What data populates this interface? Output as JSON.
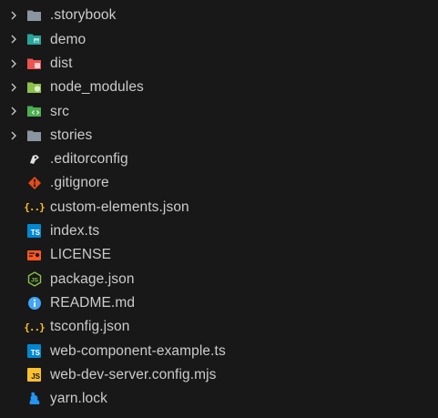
{
  "explorer": {
    "folders": [
      {
        "label": ".storybook"
      },
      {
        "label": "demo"
      },
      {
        "label": "dist"
      },
      {
        "label": "node_modules"
      },
      {
        "label": "src"
      },
      {
        "label": "stories"
      }
    ],
    "files": [
      {
        "label": ".editorconfig"
      },
      {
        "label": ".gitignore"
      },
      {
        "label": "custom-elements.json"
      },
      {
        "label": "index.ts"
      },
      {
        "label": "LICENSE"
      },
      {
        "label": "package.json"
      },
      {
        "label": "README.md"
      },
      {
        "label": "tsconfig.json"
      },
      {
        "label": "web-component-example.ts"
      },
      {
        "label": "web-dev-server.config.mjs"
      },
      {
        "label": "yarn.lock"
      }
    ],
    "icon_glyphs": {
      "json": "{..}",
      "ts": "TS",
      "js": "JS"
    },
    "colors": {
      "background": "#181818",
      "text": "#cccccc",
      "folder_gray": "#8a95a0",
      "folder_teal": "#26a69a",
      "folder_red": "#ef5350",
      "folder_green": "#8bc34a",
      "folder_src": "#4caf50",
      "json_yellow": "#fbc02d",
      "ts_blue": "#0288d1",
      "license_orange": "#ff5722",
      "git_orange": "#e64a19",
      "node_green": "#8bc34a",
      "readme_blue": "#42a5f5",
      "yarn_blue": "#2196f3"
    }
  }
}
